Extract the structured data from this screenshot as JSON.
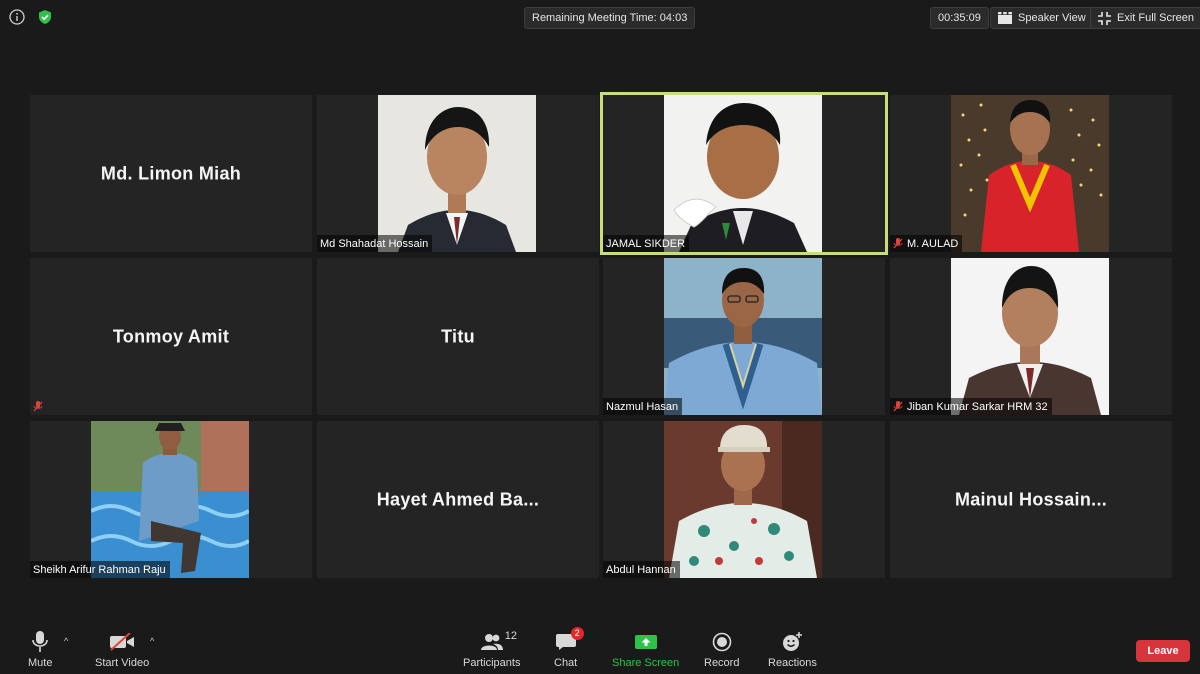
{
  "topbar": {
    "remaining_time": "Remaining Meeting Time: 04:03",
    "elapsed": "00:35:09",
    "speaker_view": "Speaker View",
    "exit_full_screen": "Exit Full Screen",
    "accent_secure": "#2ec24a"
  },
  "participants": [
    {
      "name": "Md. Limon Miah",
      "video": false,
      "muted": false
    },
    {
      "name": "Md Shahadat Hossain",
      "video": true,
      "muted": false
    },
    {
      "name": "JAMAL SIKDER",
      "video": true,
      "muted": false,
      "active_speaker": true
    },
    {
      "name": "M. AULAD",
      "video": true,
      "muted": true
    },
    {
      "name": "Tonmoy Amit",
      "video": false,
      "muted": true
    },
    {
      "name": "Titu",
      "video": false,
      "muted": false
    },
    {
      "name": "Nazmul Hasan",
      "video": true,
      "muted": false
    },
    {
      "name": "Jiban Kumar Sarkar HRM 32",
      "video": true,
      "muted": true
    },
    {
      "name": "Sheikh Arifur Rahman Raju",
      "video": true,
      "muted": false
    },
    {
      "name": "Hayet Ahmed Ba...",
      "video": false,
      "muted": false
    },
    {
      "name": "Abdul Hannan",
      "video": true,
      "muted": false
    },
    {
      "name": "Mainul Hossain...",
      "video": false,
      "muted": false
    }
  ],
  "toolbar": {
    "mute": "Mute",
    "start_video": "Start Video",
    "participants": "Participants",
    "participants_count": "12",
    "chat": "Chat",
    "chat_badge": "2",
    "share_screen": "Share Screen",
    "record": "Record",
    "reactions": "Reactions",
    "leave": "Leave",
    "share_color": "#2ec24a",
    "leave_color": "#d8343b"
  }
}
